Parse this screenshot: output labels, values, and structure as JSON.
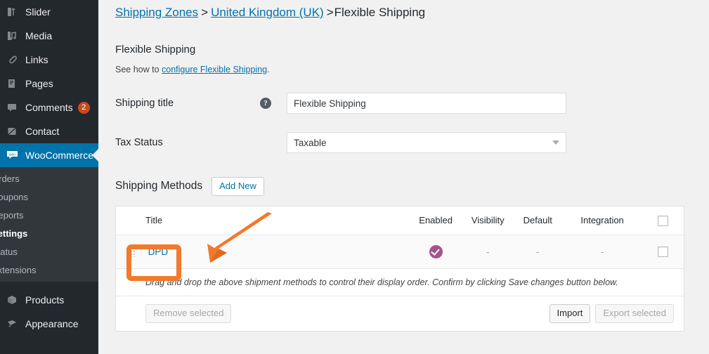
{
  "sidebar": {
    "items": [
      {
        "label": "Slider",
        "icon": "slider-icon",
        "badge": ""
      },
      {
        "label": "Media",
        "icon": "media-icon",
        "badge": ""
      },
      {
        "label": "Links",
        "icon": "links-icon",
        "badge": ""
      },
      {
        "label": "Pages",
        "icon": "pages-icon",
        "badge": ""
      },
      {
        "label": "Comments",
        "icon": "comments-icon",
        "badge": "2"
      },
      {
        "label": "Contact",
        "icon": "contact-icon",
        "badge": ""
      }
    ],
    "active_item": {
      "label": "WooCommerce",
      "icon": "woocommerce-icon"
    },
    "submenu": [
      {
        "label": "Orders",
        "current": false
      },
      {
        "label": "Coupons",
        "current": false
      },
      {
        "label": "Reports",
        "current": false
      },
      {
        "label": "Settings",
        "current": true
      },
      {
        "label": "Status",
        "current": false
      },
      {
        "label": "Extensions",
        "current": false
      }
    ],
    "bottom_items": [
      {
        "label": "Products",
        "icon": "products-icon"
      },
      {
        "label": "Appearance",
        "icon": "appearance-icon"
      }
    ],
    "colors": {
      "background": "#23282d",
      "submenu_background": "#32373c",
      "active": "#0073aa",
      "badge": "#ca4a1f"
    }
  },
  "breadcrumb": {
    "link1": "Shipping Zones",
    "sep1": ">",
    "link2": "United Kingdom (UK)",
    "sep2": ">",
    "current": "Flexible Shipping"
  },
  "page": {
    "title": "Flexible Shipping",
    "desc_prefix": "See how to ",
    "desc_link": "configure Flexible Shipping",
    "desc_suffix": "."
  },
  "form": {
    "shipping_title": {
      "label": "Shipping title",
      "help_icon": "help-icon",
      "value": "Flexible Shipping",
      "placeholder": "Flexible Shipping"
    },
    "tax_status": {
      "label": "Tax Status",
      "value": "Taxable",
      "caret_icon": "chevron-down-icon"
    }
  },
  "methods": {
    "heading": "Shipping Methods",
    "add_new_label": "Add New",
    "columns": {
      "title": "Title",
      "enabled": "Enabled",
      "visibility": "Visibility",
      "default": "Default",
      "integration": "Integration",
      "select_all": "select-all-checkbox"
    },
    "rows": [
      {
        "drag_handle": "drag-handle-icon",
        "title": "DPD",
        "enabled": "enabled-check-icon",
        "visibility": "-",
        "default": "-",
        "integration": "-",
        "checkbox": "row-checkbox"
      }
    ],
    "drag_note": "Drag and drop the above shipment methods to control their display order. Confirm by clicking Save changes button below.",
    "footer": {
      "remove_selected": "Remove selected",
      "import": "Import",
      "export_selected": "Export selected"
    },
    "colors": {
      "enabled_badge": "#a8518a",
      "link": "#0073aa"
    }
  },
  "annotation": {
    "highlight_target": "DPD",
    "shape": "rounded-rectangle-and-arrow",
    "color": "#f3792b"
  }
}
